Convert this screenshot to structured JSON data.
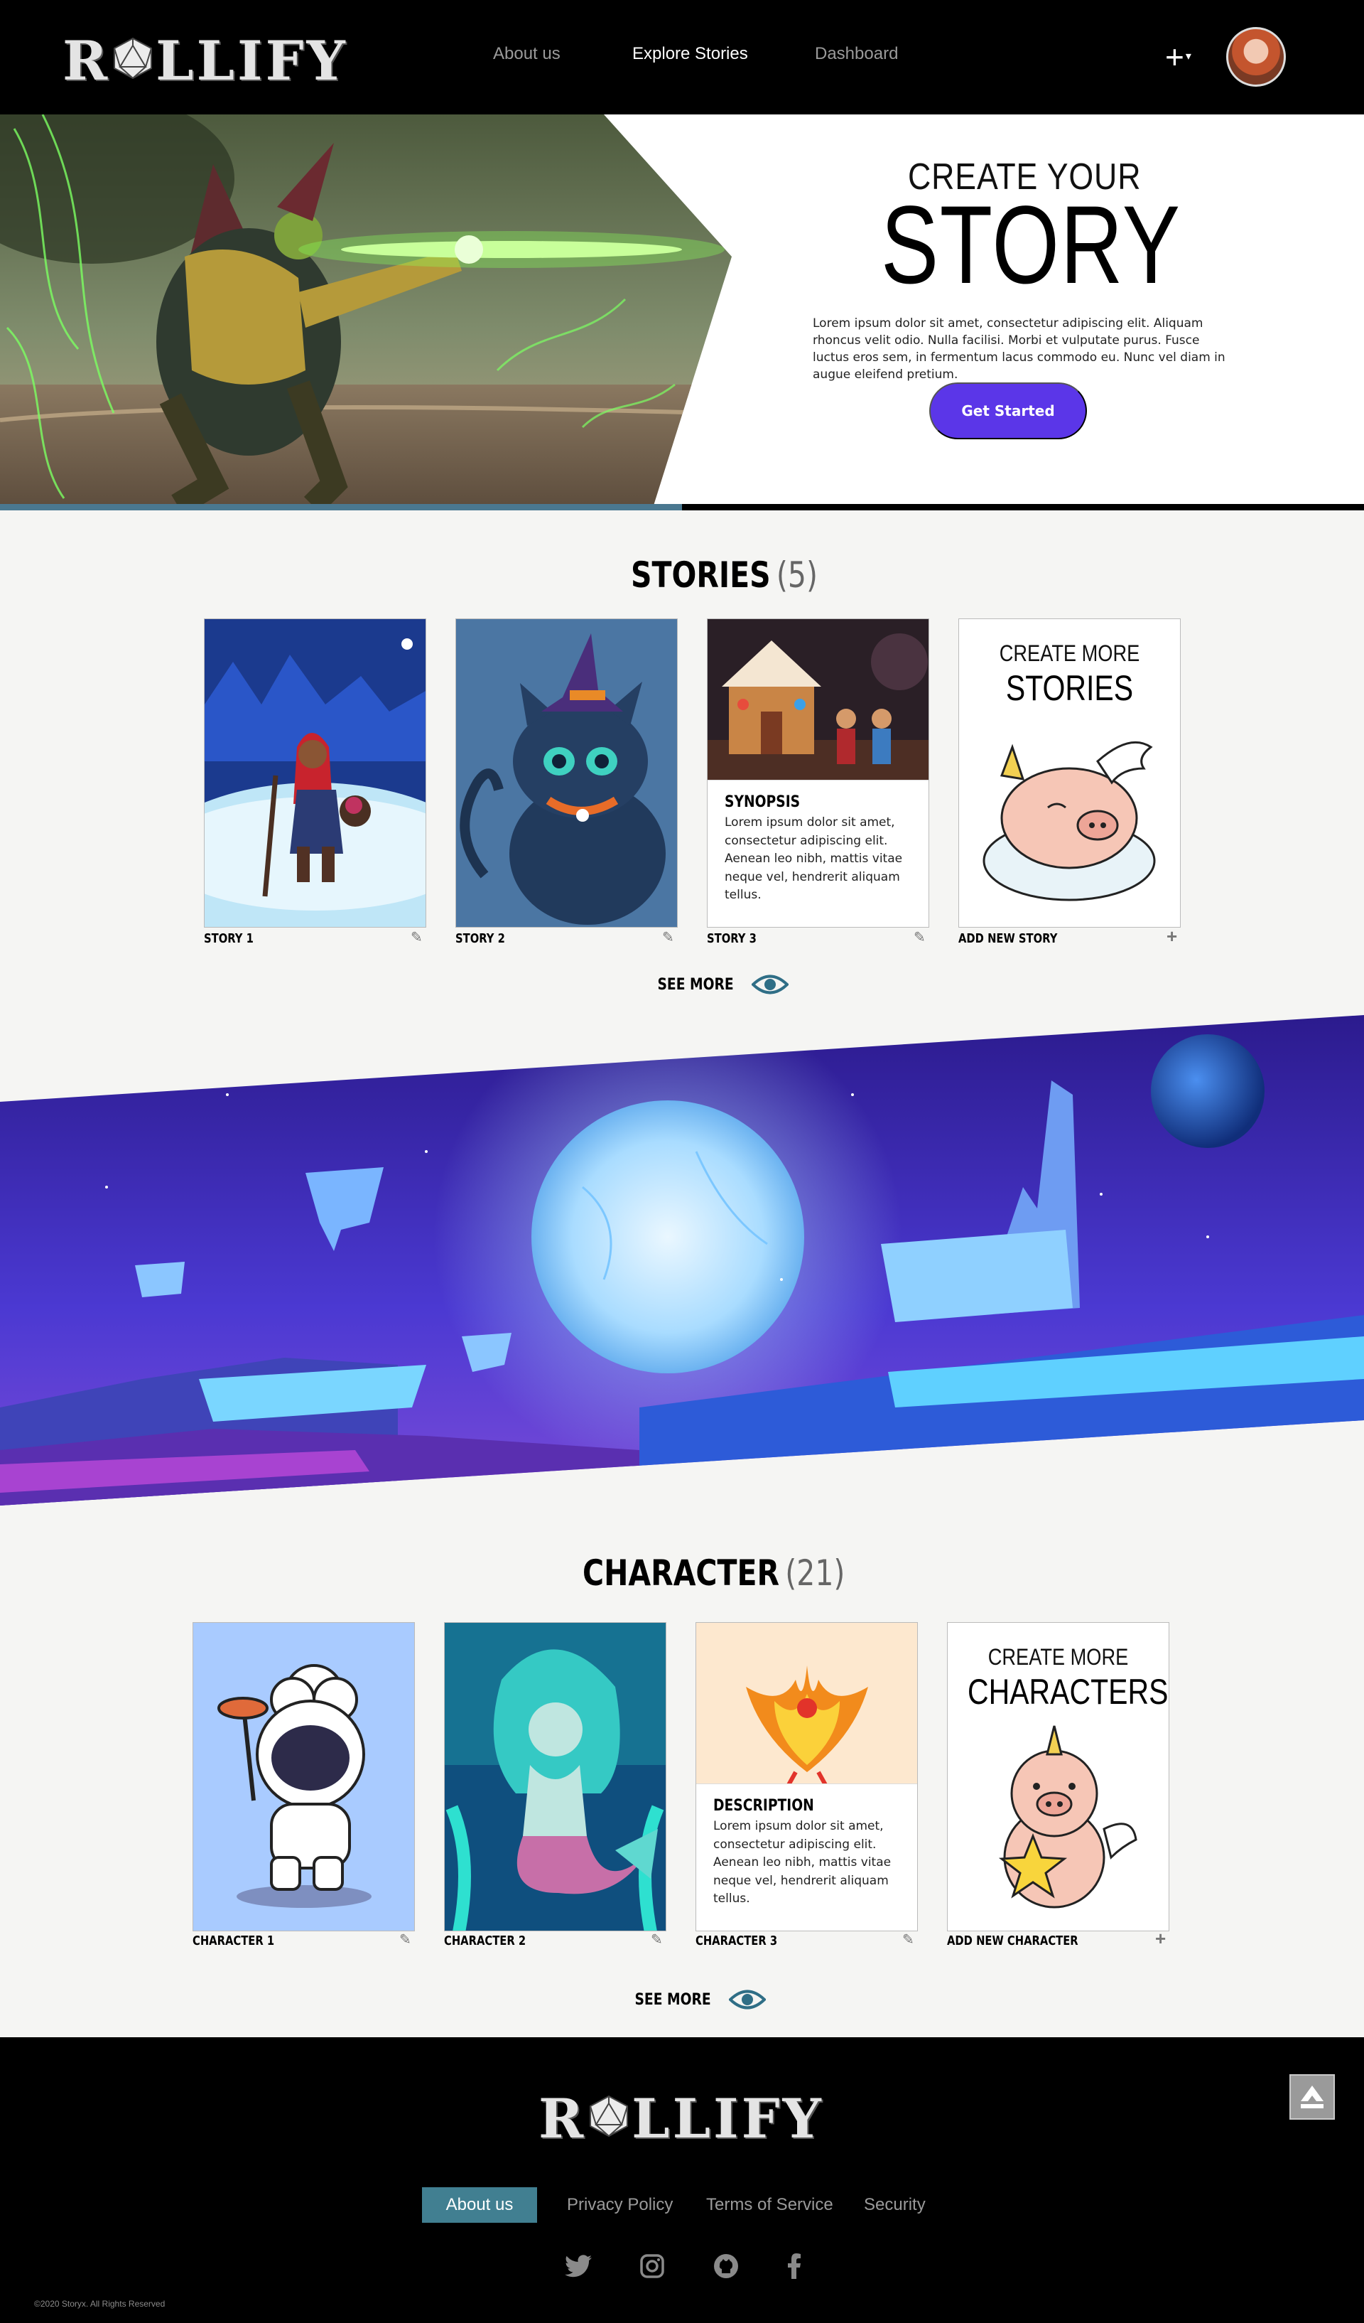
{
  "nav": {
    "logo": "ROLLIFY",
    "links": [
      "About us",
      "Explore Stories",
      "Dashboard"
    ],
    "active_link": "Explore Stories"
  },
  "hero": {
    "subtitle": "CREATE YOUR",
    "title": "STORY",
    "body": "Lorem ipsum dolor sit amet, consectetur adipiscing elit. Aliquam rhoncus velit odio. Nulla facilisi. Morbi et vulputate purus. Fusce luctus eros sem, in fermentum lacus commodo eu. Nunc vel diam in augue eleifend pretium.",
    "cta": "Get Started"
  },
  "stories": {
    "title": "STORIES",
    "count": "(5)",
    "cards": [
      {
        "label": "STORY 1",
        "art": "red-riding-hood"
      },
      {
        "label": "STORY 2",
        "art": "witch-cat"
      },
      {
        "label": "STORY 3",
        "art": "gingerbread-house",
        "info_title": "SYNOPSIS",
        "info_text": "Lorem ipsum dolor sit amet, consectetur adipiscing elit. Aenean leo nibh, mattis vitae neque vel, hendrerit aliquam tellus."
      }
    ],
    "create": {
      "line1": "CREATE MORE",
      "line2": "STORIES",
      "label": "ADD NEW STORY"
    },
    "see_more": "SEE MORE"
  },
  "characters": {
    "title": "CHARACTER",
    "count": "(21)",
    "cards": [
      {
        "label": "CHARACTER 1",
        "art": "astronaut-chef"
      },
      {
        "label": "CHARACTER 2",
        "art": "mermaid"
      },
      {
        "label": "CHARACTER 3",
        "art": "phoenix",
        "info_title": "DESCRIPTION",
        "info_text": "Lorem ipsum dolor sit amet, consectetur adipiscing elit. Aenean leo nibh, mattis vitae neque vel, hendrerit aliquam tellus."
      }
    ],
    "create": {
      "line1": "CREATE MORE",
      "line2": "CHARACTERS",
      "label": "ADD NEW CHARACTER"
    },
    "see_more": "SEE MORE"
  },
  "footer": {
    "logo": "ROLLIFY",
    "links": [
      "About us",
      "Privacy Policy",
      "Terms of Service",
      "Security"
    ],
    "active_link": "About us",
    "social": [
      "twitter-icon",
      "instagram-icon",
      "github-icon",
      "facebook-icon"
    ],
    "copyright": "©2020 Storyx. All Rights Reserved"
  },
  "colors": {
    "accent_purple": "#5b36e8",
    "footer_active": "#417f91",
    "nav_bg": "#000000",
    "page_bg": "#f5f5f3"
  }
}
